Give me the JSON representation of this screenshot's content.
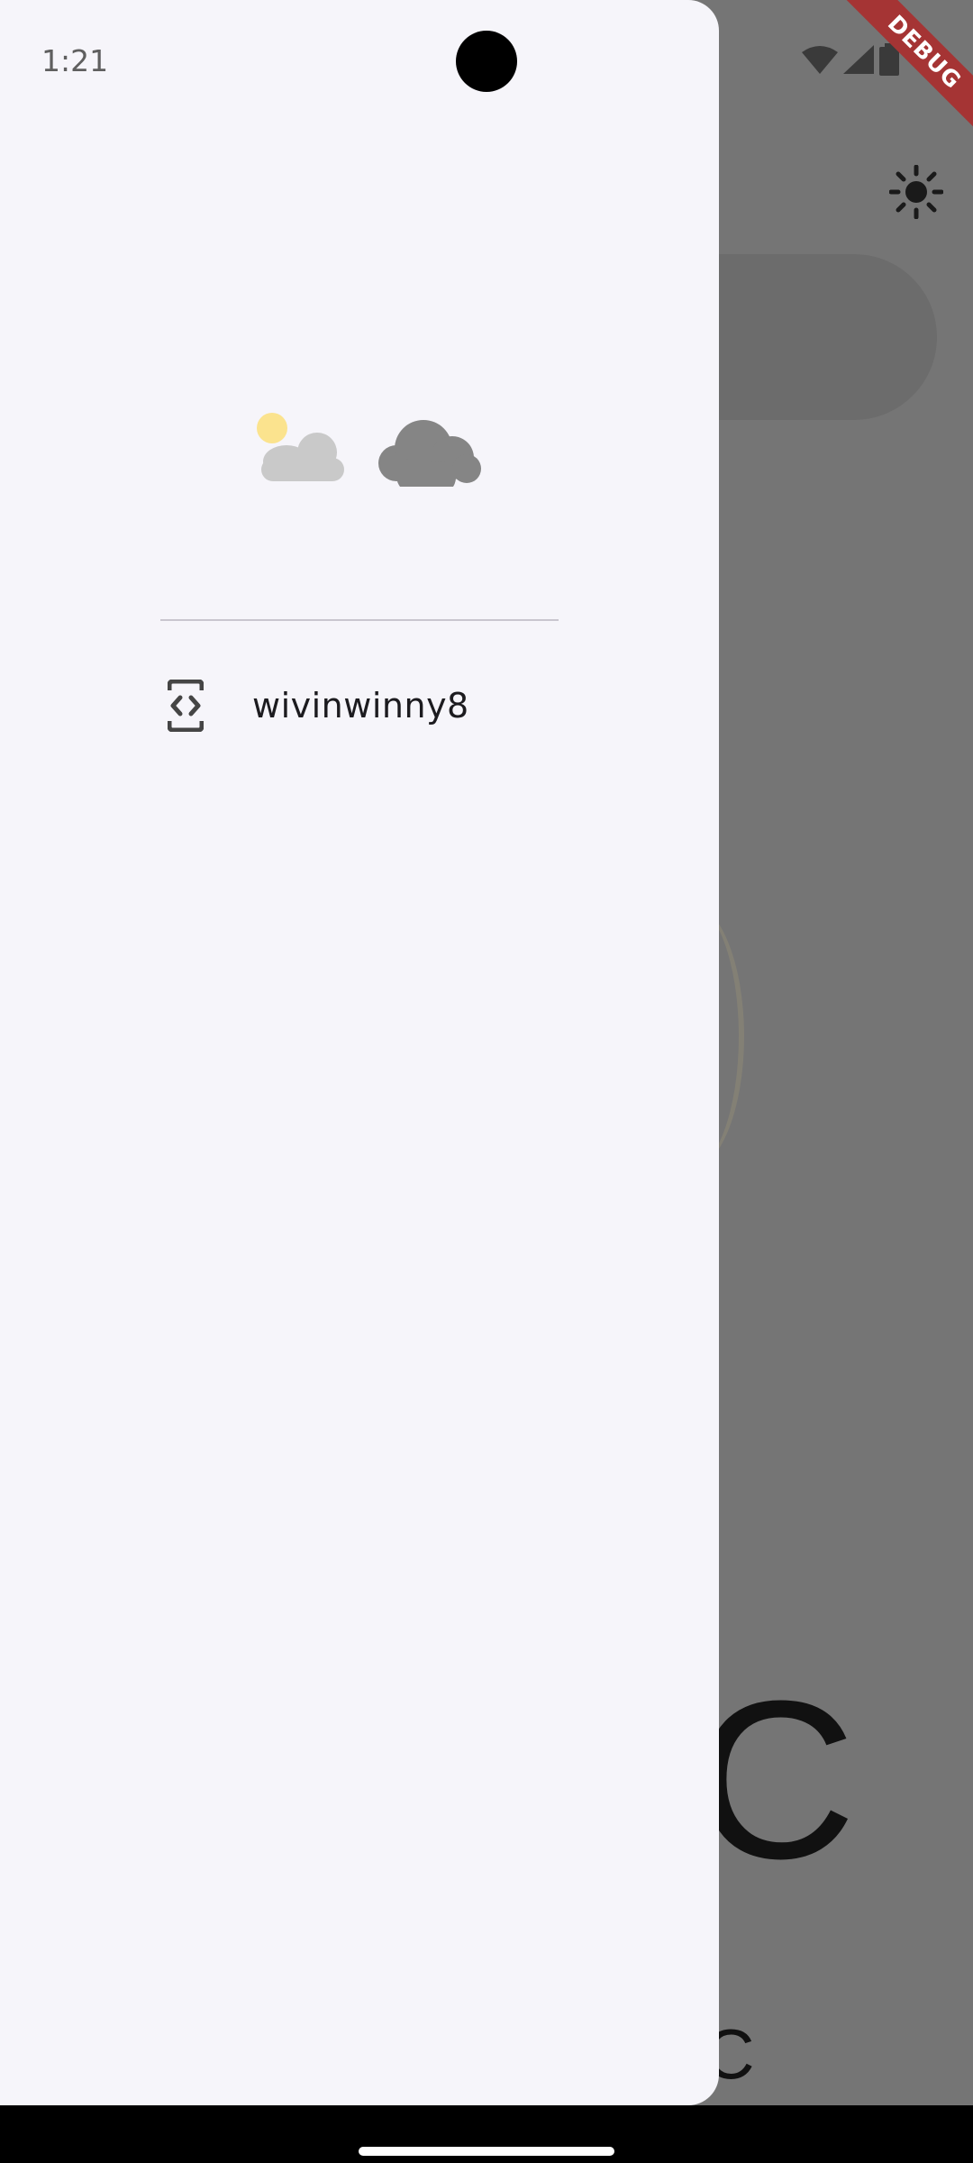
{
  "status_bar": {
    "time": "1:21"
  },
  "debug_banner": {
    "label": "DEBUG",
    "color": "#a53434"
  },
  "background_app": {
    "temperature_glyph": "C",
    "unit": "°C",
    "theme_toggle_icon": "sun-icon",
    "scrim_color": "#757575"
  },
  "drawer": {
    "background": "#f6f5fa",
    "header_art_icons": [
      "sun-behind-cloud-icon",
      "cloud-icon"
    ],
    "items": [
      {
        "icon": "code-brackets-icon",
        "label": "wivinwinny8"
      }
    ]
  }
}
